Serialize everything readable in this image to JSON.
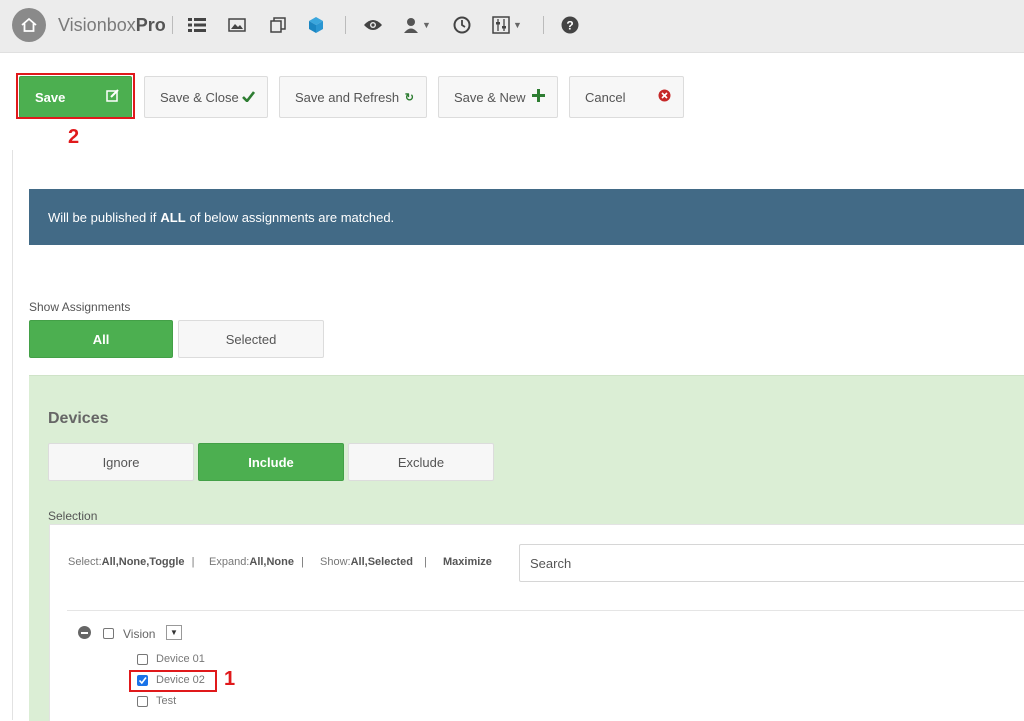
{
  "app": {
    "brand_light": "Visionbox",
    "brand_bold": "Pro"
  },
  "nav_icons": [
    "home-icon",
    "list-icon",
    "image-icon",
    "copy-icon",
    "cube-icon",
    "eye-icon",
    "user-icon",
    "clock-icon",
    "sliders-icon",
    "help-icon"
  ],
  "toolbar": {
    "save": "Save",
    "save_close": "Save & Close",
    "save_refresh": "Save and Refresh",
    "save_new": "Save & New",
    "cancel": "Cancel"
  },
  "annotations": {
    "save_marker": "2",
    "device_marker": "1"
  },
  "banner": {
    "prefix": "Will be published if",
    "keyword": "ALL",
    "suffix": "of below assignments are matched."
  },
  "show_assignments": {
    "label": "Show Assignments",
    "options": [
      "All",
      "Selected"
    ],
    "selected": "All"
  },
  "devices": {
    "title": "Devices",
    "modes": [
      "Ignore",
      "Include",
      "Exclude"
    ],
    "selected_mode": "Include",
    "selection_label": "Selection",
    "controls": {
      "select_label": "Select:",
      "select_opts": "All,None,Toggle",
      "expand_label": "Expand:",
      "expand_opts": "All,None",
      "show_label": "Show:",
      "show_opts": "All,Selected",
      "maximize": "Maximize",
      "sep": "|"
    },
    "search_placeholder": "Search",
    "tree": {
      "group": "Vision",
      "items": [
        {
          "label": "Device 01",
          "checked": false
        },
        {
          "label": "Device 02",
          "checked": true
        },
        {
          "label": "Test",
          "checked": false
        }
      ]
    }
  },
  "colors": {
    "accent_green": "#4caf50",
    "banner_blue": "#426a86",
    "highlight_red": "#e0191b",
    "panel_green": "#dbeed5"
  }
}
